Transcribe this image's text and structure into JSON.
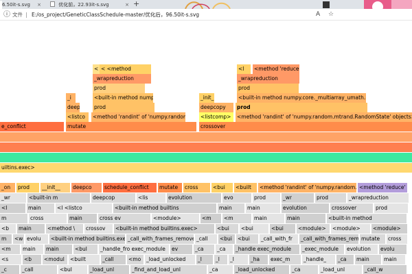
{
  "browser": {
    "tabs": [
      {
        "label": "6.50it-s.svg",
        "close": "×"
      },
      {
        "label": "优化前，22.93it-s.svg",
        "close": "×"
      },
      {
        "label": "优化后，96.50it-s.svg",
        "close": "×"
      }
    ],
    "new_tab": "+",
    "address": {
      "file_label": "文件",
      "url": "E:/os_project/GeneticClassSchedule-master/优化后，96.50it-s.svg"
    },
    "icons": [
      "back-icon",
      "refresh-icon",
      "info-icon",
      "font-size-icon",
      "favorite-icon",
      "collection-icon"
    ]
  },
  "flamegraph": {
    "top_bars": [
      {
        "label": "<  <method",
        "color": "#ffd166"
      },
      {
        "label": "_wrapreduction",
        "color": "#ff9966"
      },
      {
        "label": "prod",
        "color": "#ffd080"
      },
      {
        "label": "_i",
        "color": "#ffb366"
      },
      {
        "label": "<built-in method nump",
        "color": "#ffc266"
      },
      {
        "label": "deep",
        "color": "#ffb366"
      },
      {
        "label": "prod",
        "color": "#ffc266"
      },
      {
        "label": "<listco",
        "color": "#ffc266"
      },
      {
        "label": "<method 'randint' of 'numpy.random.m",
        "color": "#ffb366"
      },
      {
        "label": "<l",
        "color": "#ffd166"
      },
      {
        "label": "<method 'reduce' c",
        "color": "#ff9966"
      },
      {
        "label": "_wrapreduction",
        "color": "#ff9966"
      },
      {
        "label": "prod",
        "color": "#ffc266"
      },
      {
        "label": "_init_",
        "color": "#ffd166"
      },
      {
        "label": "<built-in method numpy.core._multiarray_umath.i",
        "color": "#ffb366"
      },
      {
        "label": "deepcopy",
        "color": "#ffb366"
      },
      {
        "label": "prod",
        "color": "#ffc266"
      },
      {
        "label": "<listcomp>",
        "color": "#ffff66"
      },
      {
        "label": "<method 'randint' of 'numpy.random.mtrand.RandomState' objects>",
        "color": "#ffb366"
      },
      {
        "label": "e_conflict",
        "color": "#ff6e40"
      },
      {
        "label": "mutate",
        "color": "#ff8c4a"
      },
      {
        "label": "crossover",
        "color": "#ff8c4a"
      }
    ],
    "mid_bars": [
      {
        "label": "",
        "color": "#ffa366"
      },
      {
        "label": "",
        "color": "#ff7f50"
      },
      {
        "label": "",
        "color": "#3de8a0"
      },
      {
        "label": "uiltins.exec>",
        "color": "#ffd870"
      }
    ],
    "lower_rows": [
      [
        "_on",
        "prod",
        "__init__",
        "deepco",
        "schedule_conflict",
        "mutate",
        "cross",
        "<bui",
        "<built",
        "<method 'randint' of 'numpy.random.",
        "<method 'reduce'"
      ],
      [
        "_wr",
        "<built-in m",
        "deepcop",
        "<lis",
        "evolution",
        "evo",
        "prod",
        "_wr",
        "prod",
        "_wrapreduction"
      ],
      [
        "<l",
        "main",
        "<l <listco",
        "<built-in method builtins",
        "main",
        "main",
        "evolution",
        "crossover",
        "prod"
      ],
      [
        "m",
        "cross",
        "main",
        "cross ev",
        "<module>",
        "<m",
        "<m",
        "main",
        "main",
        "<built-in method"
      ],
      [
        "<b",
        "main",
        "<method \\",
        "crossov",
        "<built-in method builtins.exec>",
        "<bui",
        "<bui",
        "<bui",
        "<module>",
        "<module>",
        "<module>"
      ],
      [
        "m",
        "<w",
        "evolu",
        "<built-in method builtins.exec>",
        "_call_with_frames_removed",
        "_call",
        "<bui",
        "<bui",
        "_call_with_fr",
        "_call_with_frames_remove",
        "mutate",
        "cross"
      ],
      [
        "<m",
        "main",
        "main",
        "<bul",
        "_handle_fro exec_module",
        "ev",
        "_ca",
        "_ca",
        "_handle exec_module",
        "_exec_module",
        "evolution",
        "evolu"
      ],
      [
        "<s",
        "<b",
        "<modul",
        "<built",
        "_call",
        "<mo",
        "_load_unlocked",
        "_l",
        "_l",
        "_l",
        "_ha",
        "exec_m",
        "_handle_",
        "_ca",
        "main",
        "main"
      ],
      [
        "_c",
        "_call",
        "<bul",
        "_load_unl",
        "_find_and_load_unl",
        "_ca",
        "_load_unlocked",
        "_ca",
        "_load_unl",
        "_call_w"
      ]
    ]
  }
}
